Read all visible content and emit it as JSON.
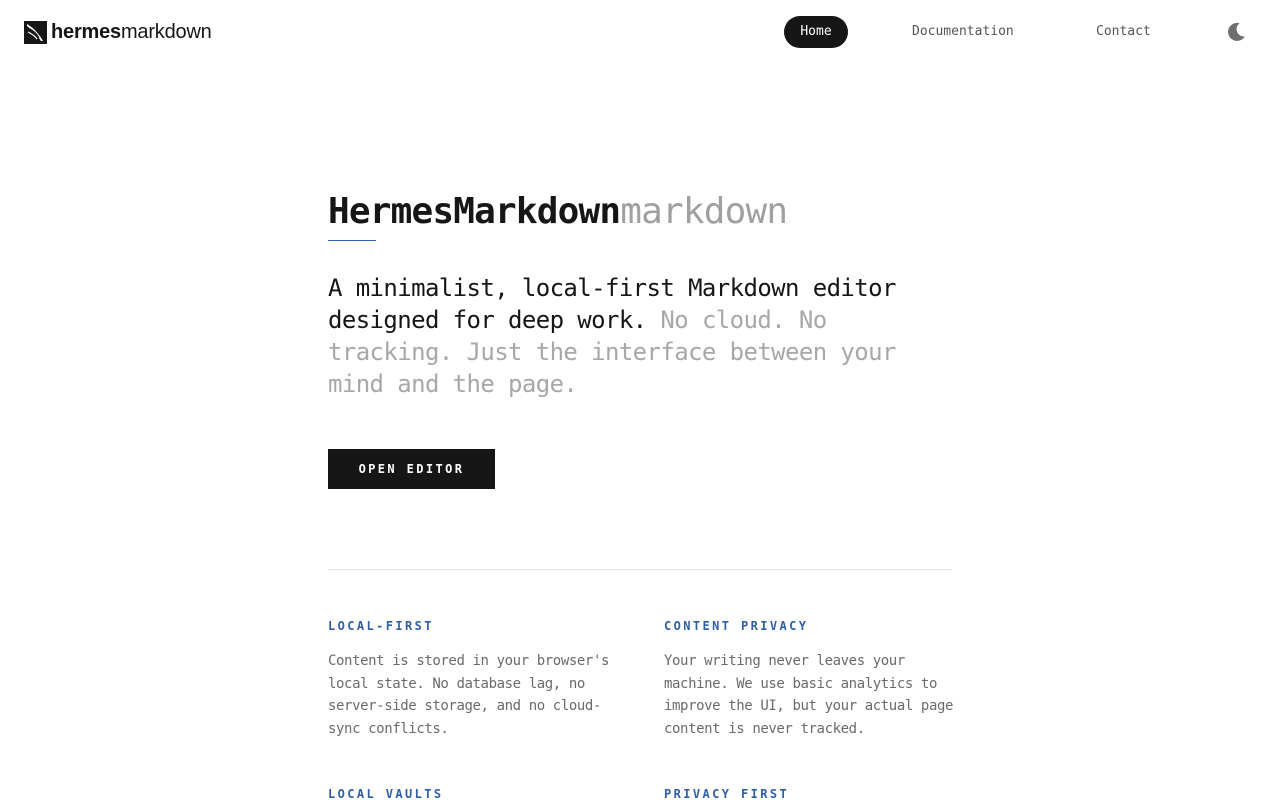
{
  "brand": {
    "name_bold": "hermes",
    "name_regular": "markdown",
    "logo_icon": "quill-icon"
  },
  "nav": {
    "home": "Home",
    "documentation": "Documentation",
    "contact": "Contact",
    "theme_icon": "moon-icon"
  },
  "hero": {
    "title_main": "HermesMarkdown",
    "title_muted": "markdown",
    "tagline_main": "A minimalist, local-first Markdown editor designed for deep work.",
    "tagline_muted": "No cloud. No tracking. Just the interface between your mind and the page.",
    "cta_label": "OPEN EDITOR"
  },
  "features": [
    {
      "title": "LOCAL-FIRST",
      "body": "Content is stored in your browser's local state. No database lag, no server-side storage, and no cloud-sync conflicts."
    },
    {
      "title": "CONTENT PRIVACY",
      "body": "Your writing never leaves your machine. We use basic analytics to improve the UI, but your actual page content is never tracked."
    },
    {
      "title": "LOCAL VAULTS",
      "body": ""
    },
    {
      "title": "PRIVACY FIRST",
      "body": ""
    }
  ],
  "colors": {
    "accent": "#2f5fa8",
    "text": "#161616",
    "muted": "#a0a0a0",
    "body": "#6b6b6b"
  }
}
